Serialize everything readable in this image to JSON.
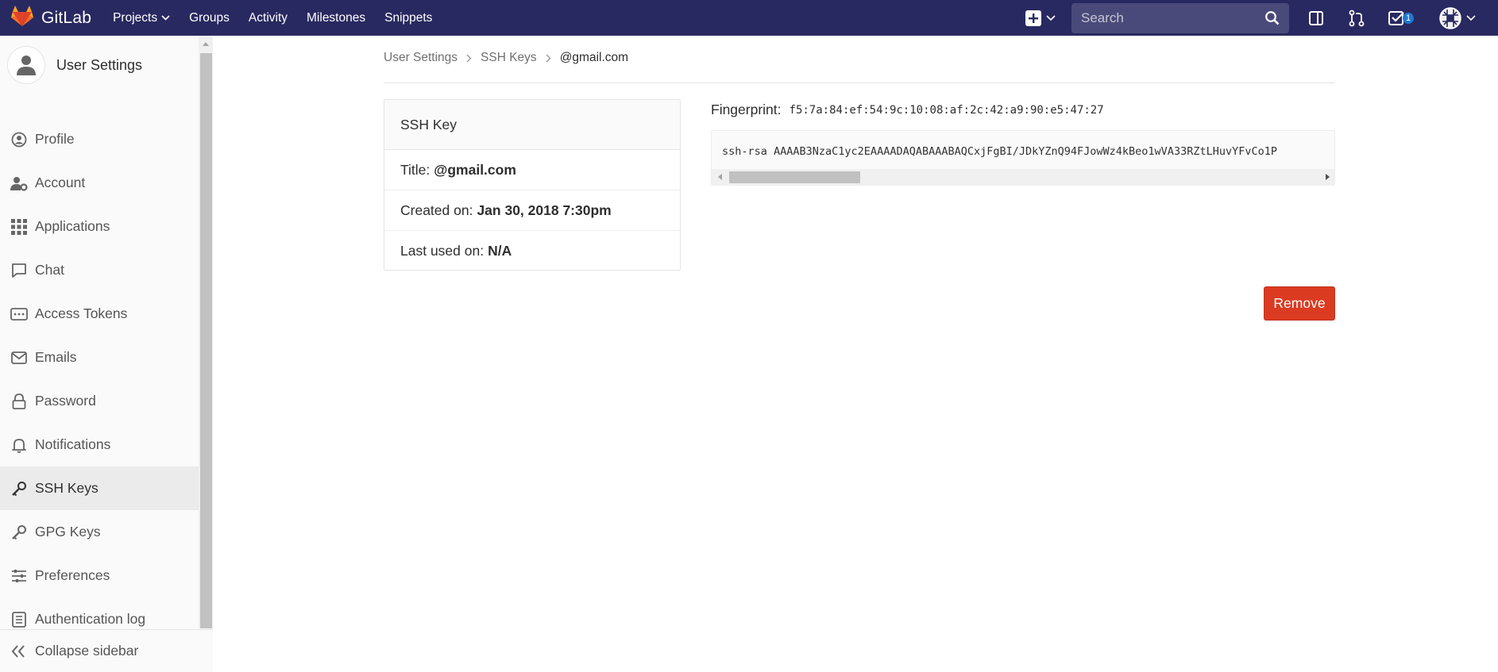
{
  "navbar": {
    "brand": "GitLab",
    "links": [
      {
        "label": "Projects",
        "has_dropdown": true
      },
      {
        "label": "Groups"
      },
      {
        "label": "Activity"
      },
      {
        "label": "Milestones"
      },
      {
        "label": "Snippets"
      }
    ],
    "search_placeholder": "Search",
    "todo_count": "1",
    "colors": {
      "background": "#292961",
      "search_bg": "#4a4a7a",
      "badge": "#1f78d1"
    }
  },
  "sidebar": {
    "title": "User Settings",
    "items": [
      {
        "label": "Profile",
        "icon": "profile-icon"
      },
      {
        "label": "Account",
        "icon": "account-icon"
      },
      {
        "label": "Applications",
        "icon": "applications-icon"
      },
      {
        "label": "Chat",
        "icon": "chat-icon"
      },
      {
        "label": "Access Tokens",
        "icon": "access-tokens-icon"
      },
      {
        "label": "Emails",
        "icon": "emails-icon"
      },
      {
        "label": "Password",
        "icon": "password-icon"
      },
      {
        "label": "Notifications",
        "icon": "notifications-icon"
      },
      {
        "label": "SSH Keys",
        "icon": "ssh-keys-icon",
        "active": true
      },
      {
        "label": "GPG Keys",
        "icon": "gpg-keys-icon"
      },
      {
        "label": "Preferences",
        "icon": "preferences-icon"
      },
      {
        "label": "Authentication log",
        "icon": "authentication-log-icon"
      }
    ],
    "collapse_label": "Collapse sidebar"
  },
  "breadcrumb": {
    "items": [
      "User Settings",
      "SSH Keys"
    ],
    "current": "@gmail.com"
  },
  "ssh_key_card": {
    "header": "SSH Key",
    "title_label": "Title:",
    "title_value": "@gmail.com",
    "created_label": "Created on:",
    "created_value": "Jan 30, 2018 7:30pm",
    "last_used_label": "Last used on:",
    "last_used_value": "N/A"
  },
  "fingerprint": {
    "label": "Fingerprint:",
    "value": "f5:7a:84:ef:54:9c:10:08:af:2c:42:a9:90:e5:47:27"
  },
  "public_key": "ssh-rsa AAAAB3NzaC1yc2EAAAADAQABAAABAQCxjFgBI/JDkYZnQ94FJowWz4kBeo1wVA33RZtLHuvYFvCo1P",
  "remove_button": {
    "label": "Remove",
    "color": "#db3b21"
  }
}
